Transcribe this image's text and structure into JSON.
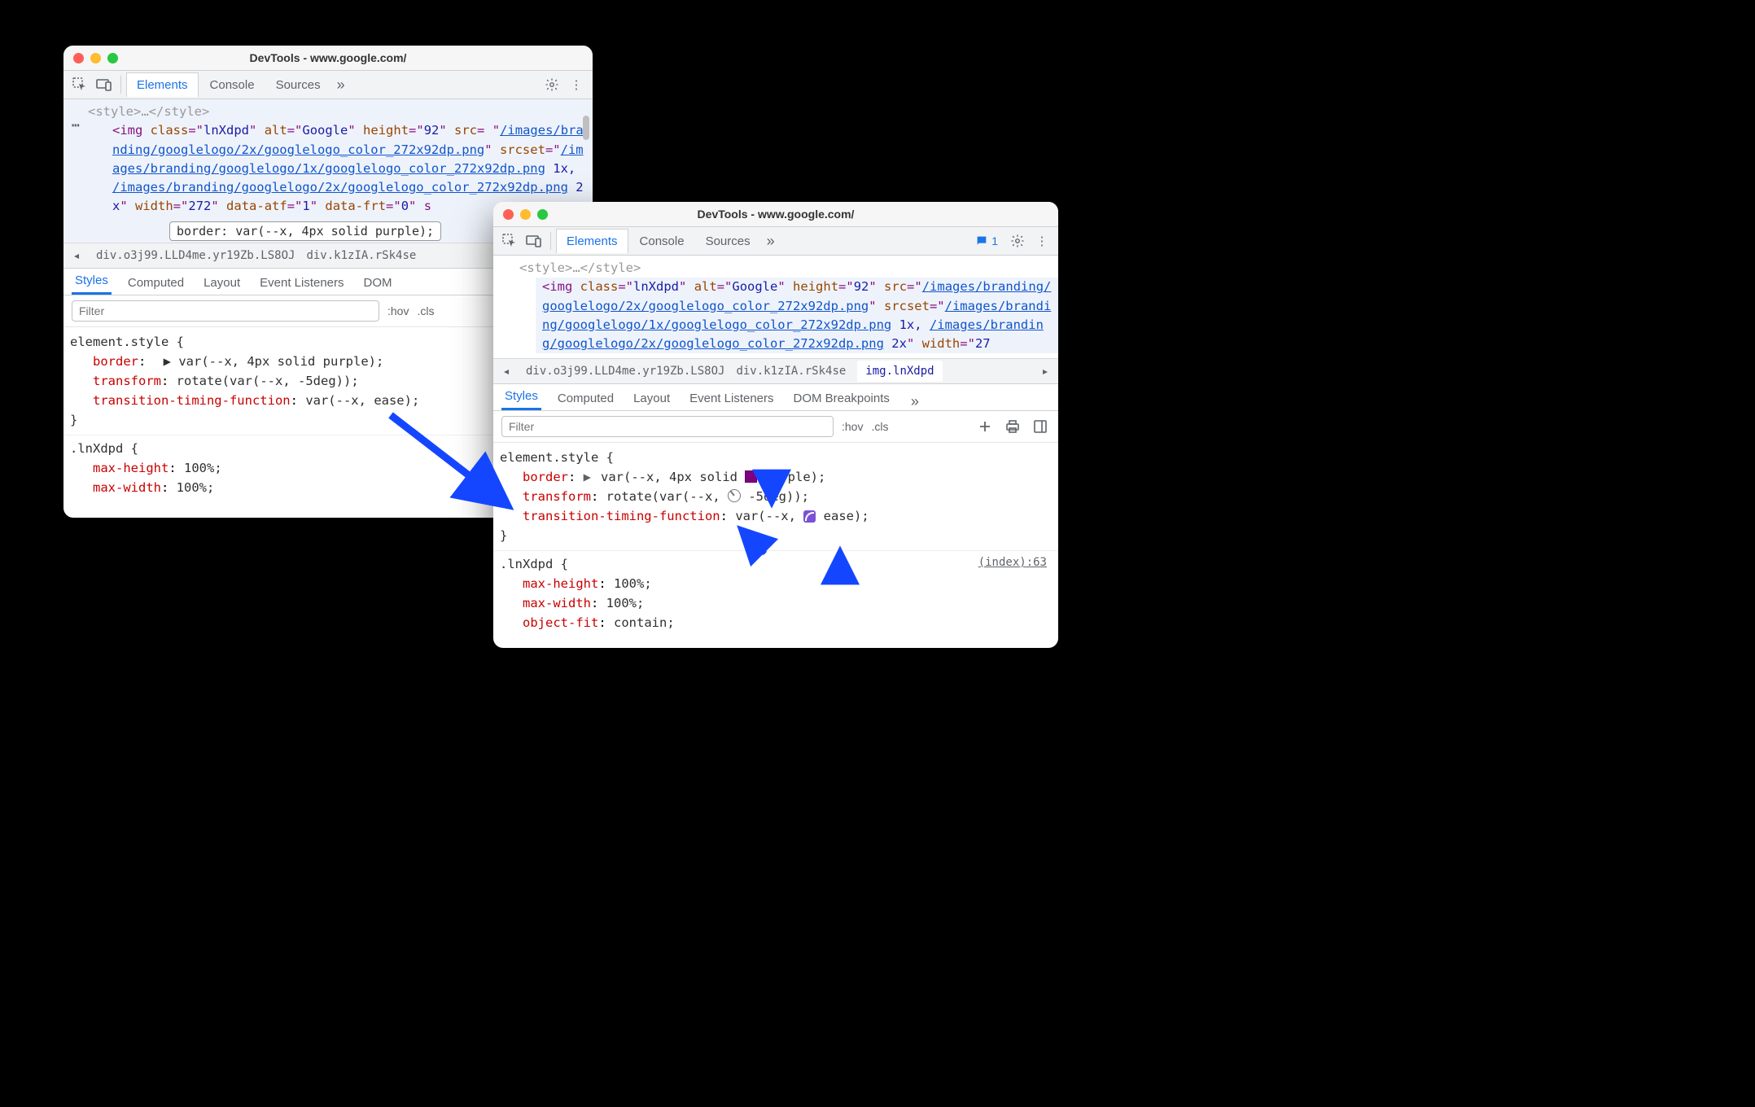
{
  "title": "DevTools - www.google.com/",
  "tabs": {
    "elements": "Elements",
    "console": "Console",
    "sources": "Sources"
  },
  "chatCount": "1",
  "dom": {
    "styleClose": "<style>…</style>",
    "imgPrefix": "<img ",
    "classAttr": "class",
    "classVal": "lnXdpd",
    "altAttr": "alt",
    "altVal": "Google",
    "heightAttr": "height",
    "heightVal": "92",
    "srcAttr": "src",
    "srcVal": "/images/branding/googlelogo/2x/googlelogo_color_272x92dp.png",
    "srcsetAttr": "srcset",
    "srcset1": "/images/branding/googlelogo/1x/googlelogo_color_272x92dp.png",
    "srcsetMid": " 1x, ",
    "srcset2": "/images/branding/googlelogo/2x/googlelogo_color_272x92dp.png",
    "srcsetEnd": " 2x",
    "widthAttr": "width",
    "widthVal": "272",
    "dataAtfAttr": "data-atf",
    "dataAtfVal": "1",
    "dataFrtAttr": "data-frt",
    "dataFrtVal": "0",
    "widthValB": "27",
    "inlineStatus": "border: var(--x, 4px solid purple);"
  },
  "crumbA1": "div.o3j99.LLD4me.yr19Zb.LS8OJ",
  "crumbA2": "div.k1zIA.rSk4se",
  "crumbB3": "img.lnXdpd",
  "subtabs": {
    "styles": "Styles",
    "computed": "Computed",
    "layout": "Layout",
    "listeners": "Event Listeners",
    "dombp": "DOM Breakpoints",
    "dombpShort": "DOM "
  },
  "filter": {
    "placeholder": "Filter",
    "hov": ":hov",
    "cls": ".cls"
  },
  "rules": {
    "elemStyle": "element.style {",
    "close": "}",
    "border_n": "border",
    "border_v_pre": "▶ var(",
    "border_v_pre2": "var(",
    "varx": "--x",
    "border_v_mid": ", 4px solid ",
    "border_v_end": "purple);",
    "transform_n": "transform",
    "transform_v_pre": "rotate(var(",
    "transform_v_mid": ", ",
    "transform_v_end": "-5deg));",
    "ttf_n": "transition-timing-function",
    "ttf_v_pre": "var(",
    "ttf_v_end": "ease);",
    "lnxSel": ".lnXdpd {",
    "mh_n": "max-height",
    "mh_v": "100%;",
    "mw_n": "max-width",
    "mw_v": "100%;",
    "of_n": "object-fit",
    "of_v": "contain;",
    "srcref": "(index):63"
  }
}
